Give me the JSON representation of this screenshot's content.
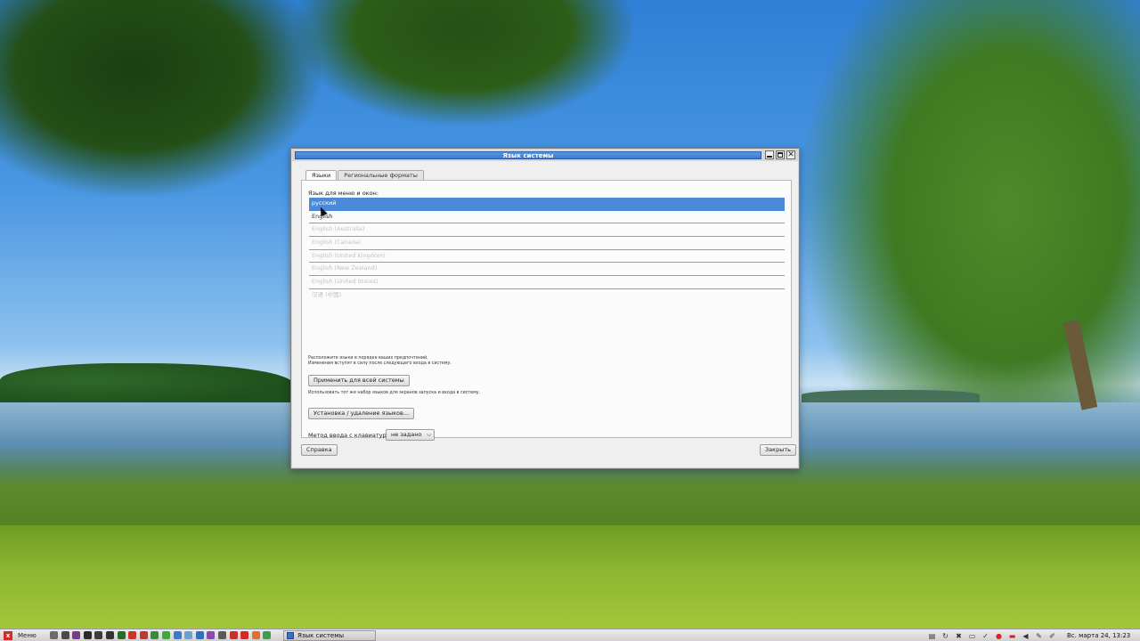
{
  "window": {
    "title": "Язык системы",
    "tabs": [
      {
        "label": "Языки",
        "active": true
      },
      {
        "label": "Региональные форматы",
        "active": false
      }
    ],
    "languages_label": "Язык для меню и окон:",
    "languages": [
      {
        "label": "русский",
        "state": "selected"
      },
      {
        "label": "English",
        "state": "active"
      },
      {
        "label": "English (Australia)",
        "state": "inactive"
      },
      {
        "label": "English (Canada)",
        "state": "inactive"
      },
      {
        "label": "English (United Kingdom)",
        "state": "inactive"
      },
      {
        "label": "English (New Zealand)",
        "state": "inactive"
      },
      {
        "label": "English (United States)",
        "state": "inactive"
      },
      {
        "label": "汉语 (中国)",
        "state": "inactive"
      }
    ],
    "hint_order_1": "Расположите языки в порядке ваших предпочтений.",
    "hint_order_2": "Изменения вступят в силу после следующего входа в систему.",
    "apply_button": "Применить для всей системы",
    "apply_hint": "Использовать тот же набор языков для экранов запуска и входа в систему.",
    "install_button": "Установка / удаление языков...",
    "keyboard_label": "Метод ввода с клавиатуры:",
    "keyboard_value": "не задано",
    "help_button": "Справка",
    "close_button": "Закрыть"
  },
  "taskbar": {
    "menu_label": "Меню",
    "launchers": [
      {
        "name": "app-a-icon",
        "color": "#6b6b6b"
      },
      {
        "name": "app-b-icon",
        "color": "#4a4a4a"
      },
      {
        "name": "app-c-icon",
        "color": "#7a3a8a"
      },
      {
        "name": "terminal-icon",
        "color": "#2b2b2b"
      },
      {
        "name": "app-d-icon",
        "color": "#3c3c3c"
      },
      {
        "name": "app-e-icon",
        "color": "#333333"
      },
      {
        "name": "app-f-icon",
        "color": "#2a6a2a"
      },
      {
        "name": "app-g-icon",
        "color": "#d0302a"
      },
      {
        "name": "app-h-icon",
        "color": "#c03a2a"
      },
      {
        "name": "app-i-icon",
        "color": "#3a8a3a"
      },
      {
        "name": "app-j-icon",
        "color": "#3faa3a"
      },
      {
        "name": "app-k-icon",
        "color": "#3a7ad0"
      },
      {
        "name": "app-l-icon",
        "color": "#6aa0d8"
      },
      {
        "name": "app-m-icon",
        "color": "#2f6fc0"
      },
      {
        "name": "app-n-icon",
        "color": "#8a4ab0"
      },
      {
        "name": "app-o-icon",
        "color": "#5a5a5a"
      },
      {
        "name": "app-p-icon",
        "color": "#c8302a"
      },
      {
        "name": "opera-icon",
        "color": "#d8282a"
      },
      {
        "name": "app-q-icon",
        "color": "#e0702a"
      },
      {
        "name": "chrome-icon",
        "color": "#3aa04a"
      }
    ],
    "task_label": "Язык системы",
    "tray_icons": [
      "window-list-icon",
      "refresh-icon",
      "tools-icon",
      "display-icon",
      "shield-icon",
      "app-red-icon",
      "flag-ru-icon",
      "volume-icon",
      "pen-icon",
      "pen2-icon"
    ],
    "clock": "Вс. марта 24, 13:23"
  }
}
